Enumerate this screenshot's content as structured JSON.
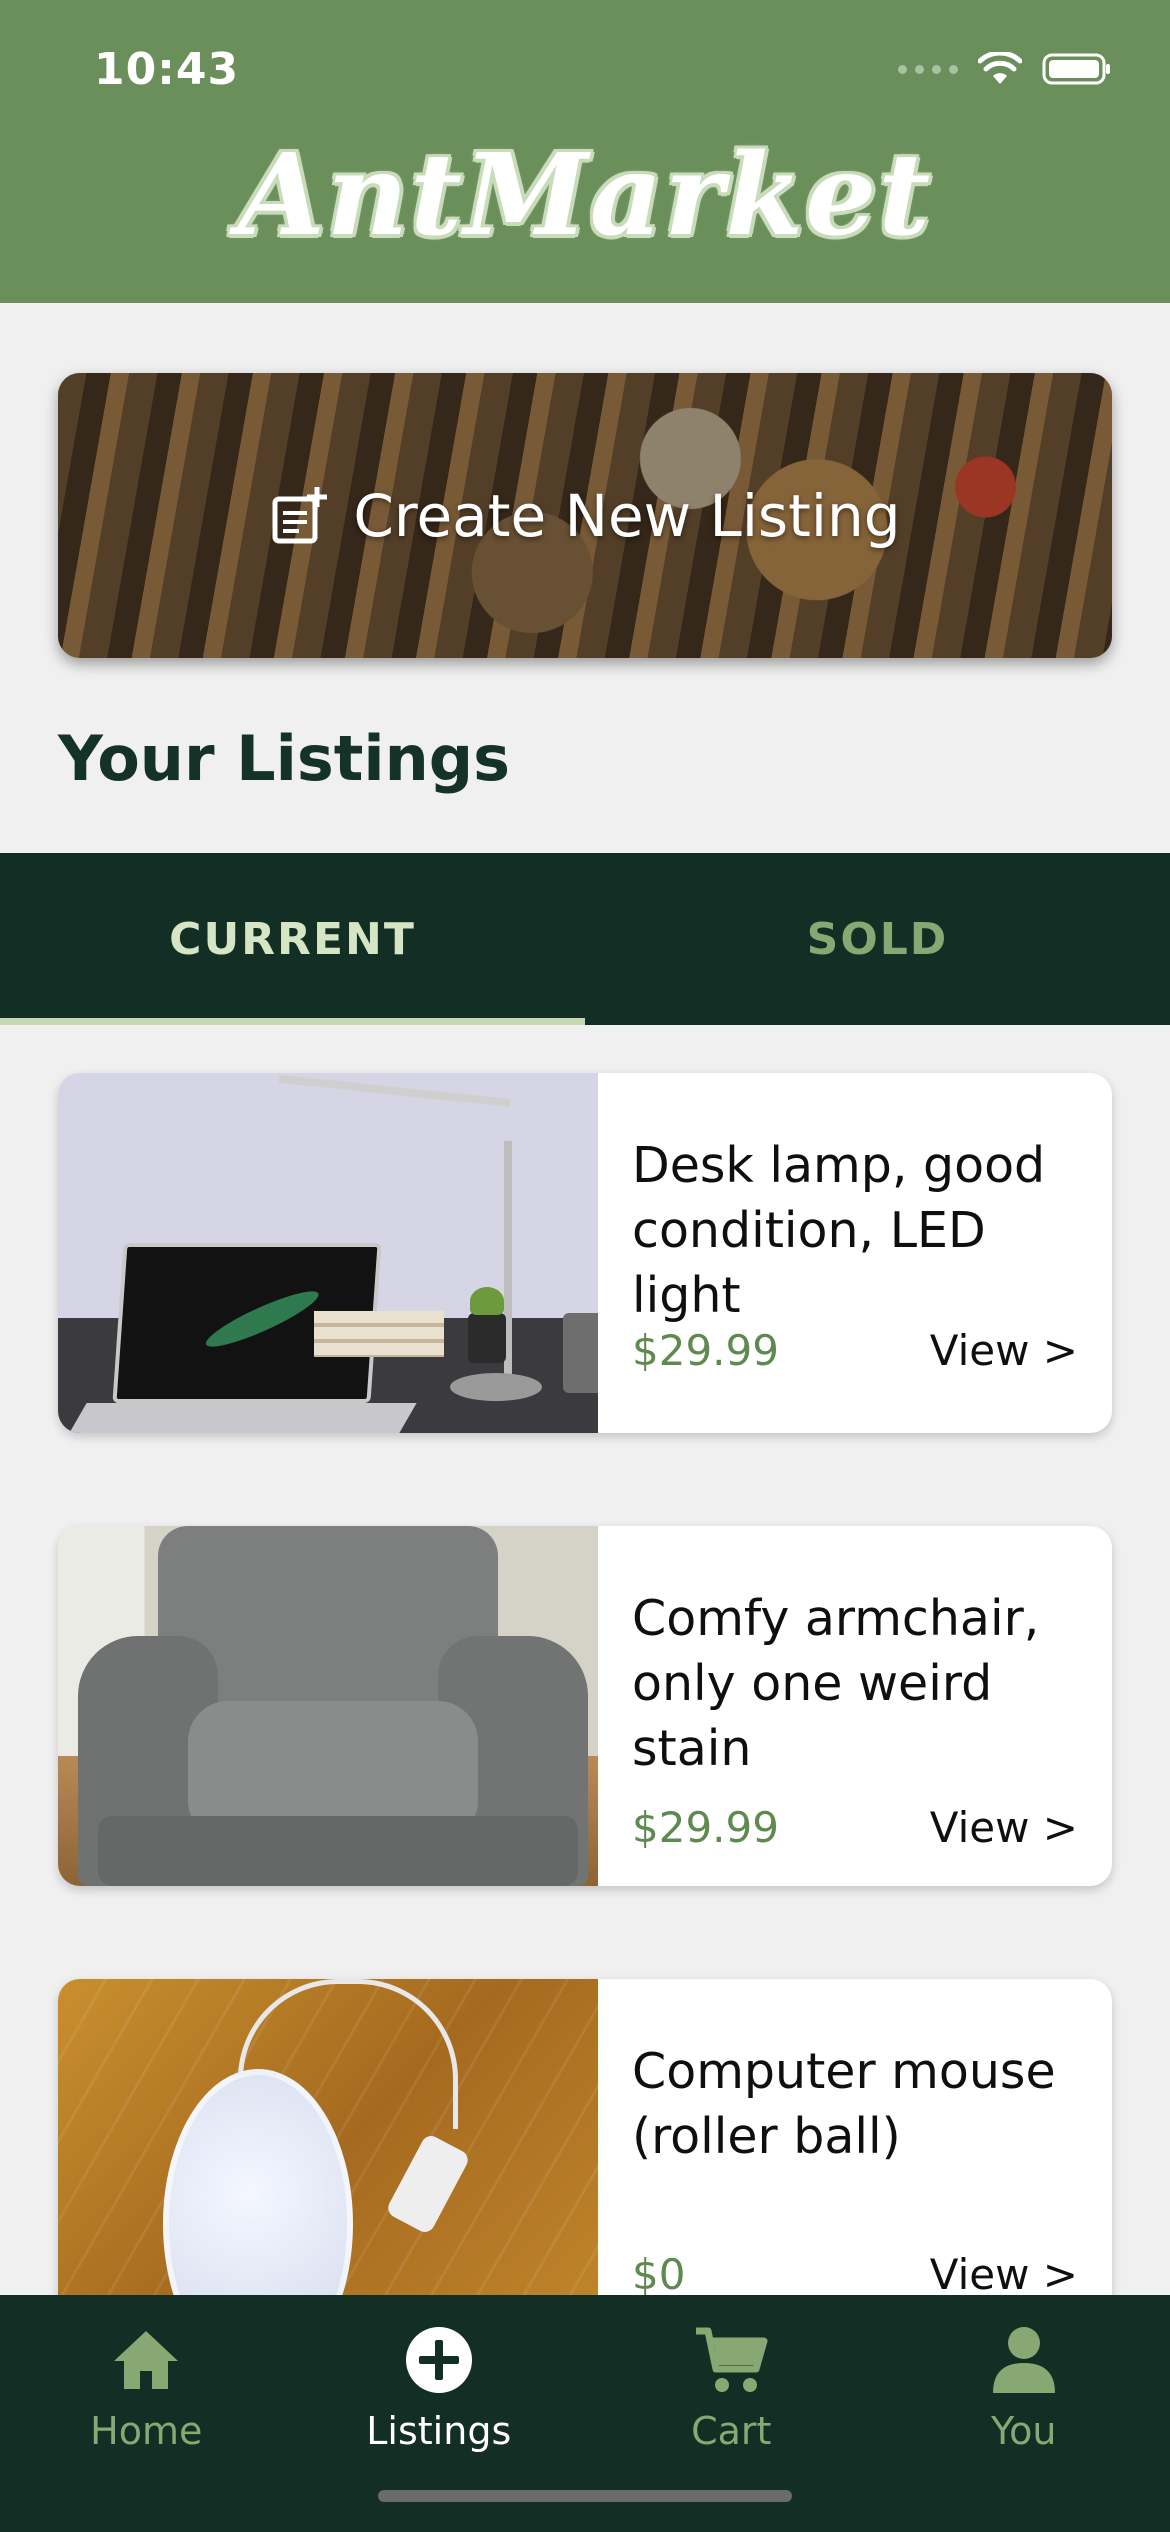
{
  "status_bar": {
    "time": "10:43"
  },
  "header": {
    "app_name": "AntMarket"
  },
  "create_listing": {
    "label": "Create New Listing",
    "icon": "add-note-icon"
  },
  "section": {
    "title": "Your Listings"
  },
  "tabs": [
    {
      "label": "CURRENT",
      "active": true
    },
    {
      "label": "SOLD",
      "active": false
    }
  ],
  "listings": [
    {
      "title": "Desk lamp, good condition, LED light",
      "price": "$29.99",
      "action": "View >",
      "image": "desk-lamp-photo"
    },
    {
      "title": "Comfy armchair, only one weird stain",
      "price": "$29.99",
      "action": "View >",
      "image": "armchair-photo"
    },
    {
      "title": "Computer mouse (roller ball)",
      "price": "$0",
      "action": "View >",
      "image": "computer-mouse-photo"
    }
  ],
  "bottom_nav": [
    {
      "label": "Home",
      "icon": "home-icon",
      "active": false
    },
    {
      "label": "Listings",
      "icon": "plus-circle-icon",
      "active": true
    },
    {
      "label": "Cart",
      "icon": "cart-icon",
      "active": false
    },
    {
      "label": "You",
      "icon": "person-icon",
      "active": false
    }
  ],
  "colors": {
    "header_green": "#6a8f5b",
    "dark_green": "#132e24",
    "accent_light_green": "#c4d9b0",
    "price_green": "#5f8a4f",
    "background": "#f0f0f0"
  }
}
